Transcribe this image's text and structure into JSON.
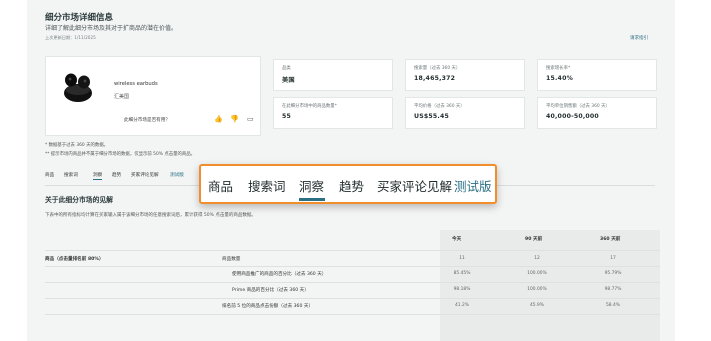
{
  "header": {
    "title": "细分市场详细信息",
    "subtitle": "详细了解此细分市场及其对于扩商品的潜在价值。",
    "last_updated": "上次更新日期：1/11/2025",
    "feedback_link": "请求指引"
  },
  "product": {
    "image_icon": "wireless-earbuds-image",
    "name": "wireless earbuds",
    "brand": "汇美国",
    "useful_question": "此细分市场是否有用？",
    "icons": [
      "thumbs-up-icon",
      "thumbs-down-icon",
      "comment-icon"
    ]
  },
  "stats": [
    {
      "label": "品类",
      "value": "美国"
    },
    {
      "label": "搜索量（过去 360 天）",
      "value": "18,465,372"
    },
    {
      "label": "搜索增长率*",
      "value": "15.40%"
    },
    {
      "label": "在此细分市场中的商品数量*",
      "value": "55"
    },
    {
      "label": "平均价格（过去 360 天）",
      "value": "US$55.45"
    },
    {
      "label": "平均单位销售额（过去 360 天）",
      "value": "40,000-50,000"
    }
  ],
  "notes": [
    "* 数据基于过去 360 天的数据。",
    "** 提示市场内商品并不属于细分市场的数据，仅显示前 50% 点击量的商品。"
  ],
  "tabs": {
    "small": [
      "商品",
      "搜索词",
      "洞察",
      "趋势",
      "买家评论见解",
      "测试版"
    ],
    "zoomed": [
      "商品",
      "搜索词",
      "洞察",
      "趋势",
      "买家评论见解",
      "测试版"
    ],
    "active_index": 2
  },
  "insights": {
    "title": "关于此细分市场的见解",
    "description": "下表中的所有指标均计算在买家输入属于该细分市场的任意搜索词后，累计获得 50% 点击量的商品数据。",
    "columns": [
      "今天",
      "90 天前",
      "360 天前"
    ],
    "rows": [
      {
        "label": "商品（点击量排名前 80%）",
        "values": [
          "",
          "",
          ""
        ]
      },
      {
        "label": "商品数量",
        "values": [
          "11",
          "12",
          "17"
        ]
      },
      {
        "label": "使用商品推广的商品的百分比（过去 360 天）",
        "values": [
          "85.45%",
          "100.00%",
          "95.79%"
        ]
      },
      {
        "label": "Prime 商品的百分比（过去 360 天）",
        "values": [
          "98.18%",
          "100.00%",
          "98.77%"
        ]
      },
      {
        "label": "排名前 5 位的商品点击份额（过去 360 天）",
        "values": [
          "41.2%",
          "45.9%",
          "58.4%"
        ]
      }
    ]
  }
}
